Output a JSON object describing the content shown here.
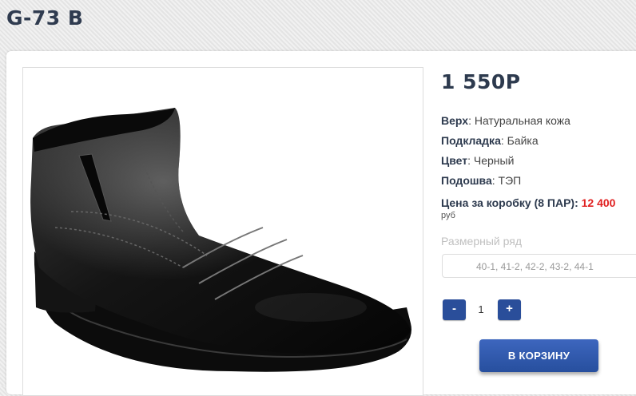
{
  "product": {
    "title": "G-73 B",
    "price": "1 550Р",
    "image_alt": "black leather boot"
  },
  "specs": [
    {
      "label": "Верх",
      "value": ": Натуральная кожа"
    },
    {
      "label": "Подкладка",
      "value": ": Байка"
    },
    {
      "label": "Цвет",
      "value": ": Черный"
    },
    {
      "label": "Подошва",
      "value": ": ТЭП"
    }
  ],
  "box_price": {
    "label": "Цена за коробку (8 ПАР):",
    "value": "12 400",
    "unit": "руб"
  },
  "sizes": {
    "label": "Размерный ряд",
    "selected": "40-1, 41-2, 42-2, 43-2, 44-1"
  },
  "quantity": {
    "minus": "-",
    "value": "1",
    "plus": "+"
  },
  "cart_button": "В КОРЗИНУ",
  "colors": {
    "accent": "#2a4e9a",
    "price_red": "#e02020",
    "title": "#2f3b4f"
  }
}
